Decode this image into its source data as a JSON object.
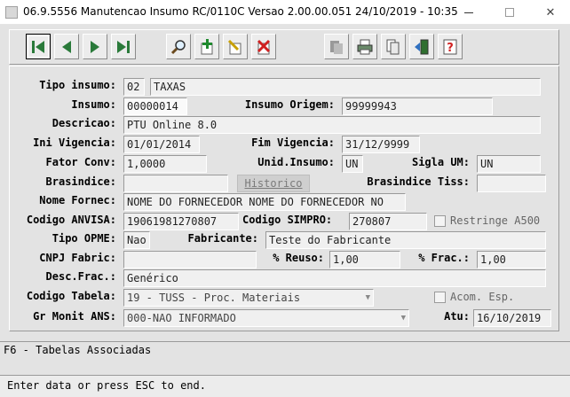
{
  "window": {
    "title": "06.9.5556 Manutencao Insumo RC/0110C Versao 2.00.00.051 24/10/2019 - 10:35",
    "minimize": "–",
    "maximize": "□",
    "close": "✕"
  },
  "toolbar": {
    "buttons": [
      {
        "icon": "first-record-icon"
      },
      {
        "icon": "previous-record-icon"
      },
      {
        "icon": "next-record-icon"
      },
      {
        "icon": "last-record-icon"
      },
      {
        "icon": "search-icon"
      },
      {
        "icon": "add-icon"
      },
      {
        "icon": "edit-icon"
      },
      {
        "icon": "delete-icon"
      },
      {
        "icon": "copy-icon"
      },
      {
        "icon": "print-icon"
      },
      {
        "icon": "duplicate-icon"
      },
      {
        "icon": "exit-icon"
      },
      {
        "icon": "help-icon"
      }
    ]
  },
  "form": {
    "tipo_insumo": {
      "label": "Tipo insumo:",
      "code": "02",
      "desc": "TAXAS"
    },
    "insumo": {
      "label": "Insumo:",
      "value": "00000014"
    },
    "insumo_origem": {
      "label": "Insumo Origem:",
      "value": "99999943"
    },
    "descricao": {
      "label": "Descricao:",
      "value": "PTU Online 8.0"
    },
    "ini_vigencia": {
      "label": "Ini Vigencia:",
      "value": "01/01/2014"
    },
    "fim_vigencia": {
      "label": "Fim Vigencia:",
      "value": "31/12/9999"
    },
    "fator_conv": {
      "label": "Fator Conv:",
      "value": "1,0000"
    },
    "unid_insumo": {
      "label": "Unid.Insumo:",
      "value": "UN"
    },
    "sigla_um": {
      "label": "Sigla UM:",
      "value": "UN"
    },
    "brasindice": {
      "label": "Brasindice:",
      "value": ""
    },
    "historico": {
      "label": "Historico"
    },
    "brasindice_tiss": {
      "label": "Brasindice Tiss:",
      "value": ""
    },
    "nome_fornec": {
      "label": "Nome Fornec:",
      "value": "NOME DO FORNECEDOR NOME DO FORNECEDOR NO"
    },
    "codigo_anvisa": {
      "label": "Codigo ANVISA:",
      "value": "19061981270807"
    },
    "codigo_simpro": {
      "label": "Codigo SIMPRO:",
      "value": "270807"
    },
    "restringe": {
      "label": "Restringe A500"
    },
    "tipo_opme": {
      "label": "Tipo OPME:",
      "value": "Nao"
    },
    "fabricante": {
      "label": "Fabricante:",
      "value": "Teste do Fabricante"
    },
    "cnpj_fabric": {
      "label": "CNPJ Fabric:",
      "value": ""
    },
    "pct_reuso": {
      "label": "% Reuso:",
      "value": "1,00"
    },
    "pct_frac": {
      "label": "% Frac.:",
      "value": "1,00"
    },
    "desc_frac": {
      "label": "Desc.Frac.:",
      "value": "Genérico"
    },
    "codigo_tabela": {
      "label": "Codigo Tabela:",
      "value": "19 - TUSS - Proc. Materiais"
    },
    "acom_esp": {
      "label": "Acom. Esp."
    },
    "gr_monit_ans": {
      "label": "Gr Monit ANS:",
      "value": "000-NAO INFORMADO"
    },
    "atu": {
      "label": "Atu:",
      "value": "16/10/2019"
    }
  },
  "status": {
    "hint": "F6 - Tabelas Associadas",
    "message": "Enter data or press ESC to end."
  }
}
